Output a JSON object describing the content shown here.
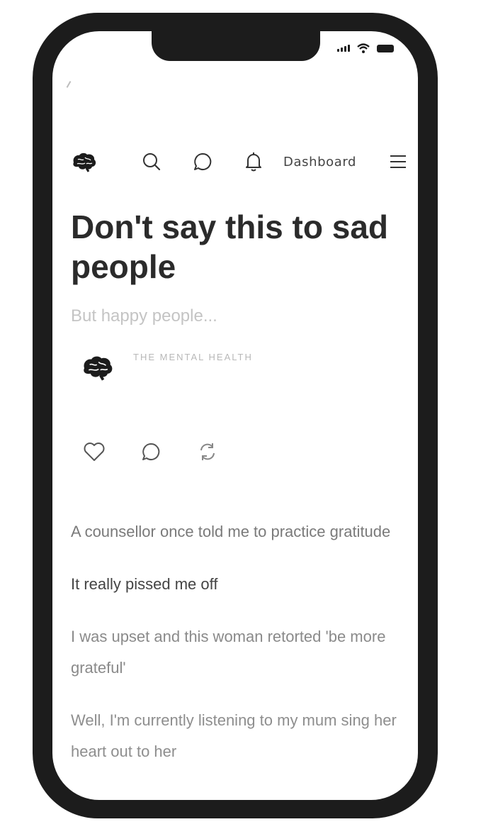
{
  "nav": {
    "dashboard_label": "Dashboard",
    "icons": [
      "brain-logo-icon",
      "search-icon",
      "chat-icon",
      "bell-icon",
      "hamburger-menu-icon"
    ]
  },
  "article": {
    "title": "Don't say this to sad people",
    "subtitle": "But happy people...",
    "author": {
      "name": "THE MENTAL HEALTH",
      "date": ""
    },
    "actions": [
      "heart-icon",
      "comment-icon",
      "repost-icon"
    ],
    "paragraphs": [
      "A counsellor once told me to practice gratitude",
      "It really pissed me off",
      "I was upset and this woman retorted 'be more grateful'",
      "Well, I'm currently listening to my mum sing her heart out to her"
    ]
  },
  "colors": {
    "frame": "#1c1c1c",
    "title": "#2b2b2b",
    "subtitle": "#c4c4c4"
  }
}
